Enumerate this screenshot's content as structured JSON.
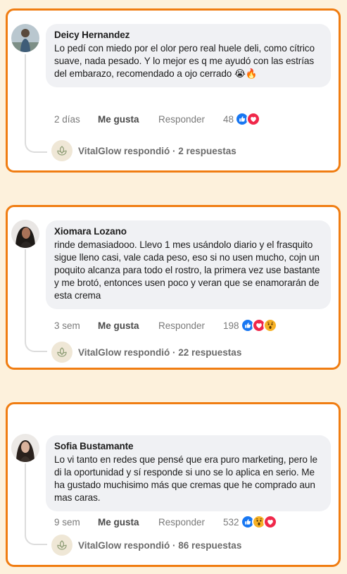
{
  "colors": {
    "accent": "#f07d12",
    "background": "#fdf1dc",
    "like_blue": "#1877f2",
    "heart_red": "#f0284a",
    "wow_yellow": "#f7b125"
  },
  "comments": [
    {
      "author": "Deicy Hernandez",
      "text": "Lo pedí con miedo por el olor pero real huele deli, como cítrico suave, nada pesado. Y lo mejor es q me ayudó con las estrías del embarazo, recomendado a ojo cerrado 😭🔥",
      "time": "2 días",
      "like_label": "Me gusta",
      "reply_label": "Responder",
      "reaction_count": "48",
      "reactions": [
        "like-icon",
        "heart-icon"
      ],
      "brand_reply": "VitalGlow respondió · 2 respuestas"
    },
    {
      "author": "Xiomara Lozano",
      "text": "rinde demasiadooo. Llevo 1 mes usándolo diario y el frasquito sigue lleno casi, vale cada peso, eso si no usen mucho, cojn un poquito alcanza para todo el rostro, la primera vez use bastante y me brotó, entonces usen poco y veran que se enamorarán de esta crema",
      "time": "3 sem",
      "like_label": "Me gusta",
      "reply_label": "Responder",
      "reaction_count": "198",
      "reactions": [
        "like-icon",
        "heart-icon",
        "wow-icon"
      ],
      "brand_reply": "VitalGlow respondió · 22 respuestas"
    },
    {
      "author": "Sofia Bustamante",
      "text": "Lo vi tanto en redes que pensé que era puro marketing, pero le di la oportunidad y sí responde si uno se lo aplica en serio. Me ha gustado muchisimo más que cremas que he comprado aun mas caras.",
      "time": "9 sem",
      "like_label": "Me gusta",
      "reply_label": "Responder",
      "reaction_count": "532",
      "reactions": [
        "like-icon",
        "wow-icon",
        "heart-icon"
      ],
      "brand_reply": "VitalGlow respondió · 86 respuestas"
    }
  ]
}
